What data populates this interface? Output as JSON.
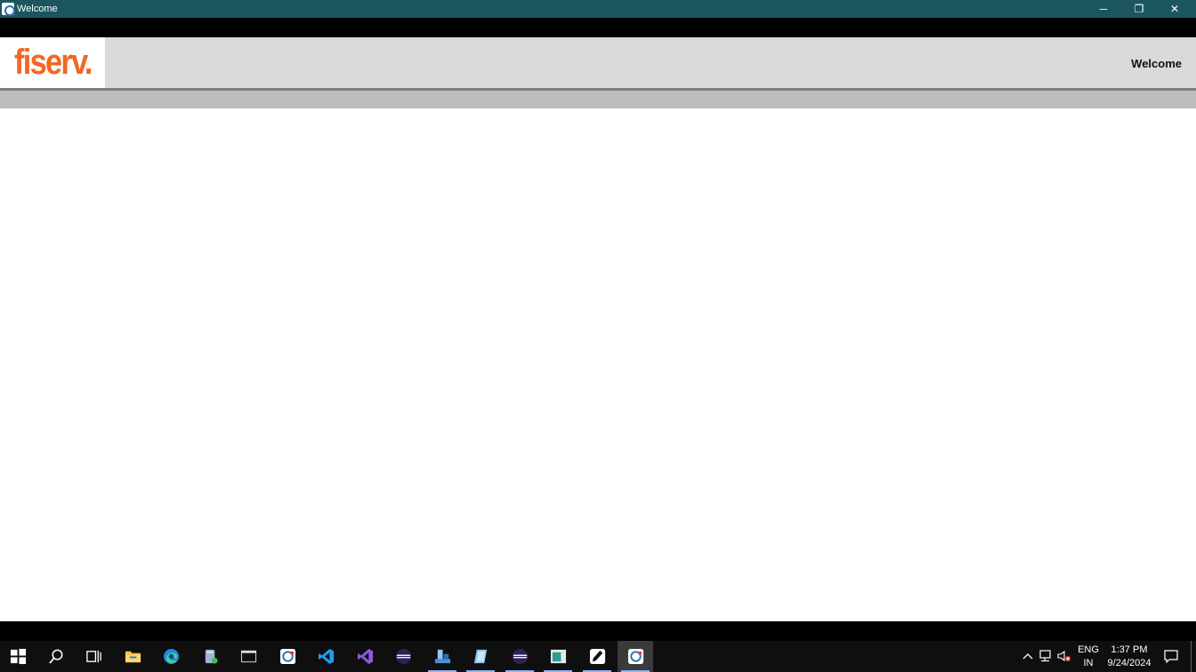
{
  "window": {
    "title": "Welcome",
    "minimize_glyph": "─",
    "restore_glyph": "❐",
    "close_glyph": "✕"
  },
  "header": {
    "logo": "fiserv.",
    "title": "Welcome"
  },
  "colors": {
    "titlebar": "#1b5560",
    "brand_orange": "#f26722",
    "header_bg": "#d9d9d9",
    "subbar": "#bdbdbd",
    "taskbar": "#0f0f0f"
  },
  "taskbar": {
    "items": [
      {
        "name": "start-button",
        "icon": "windows-icon"
      },
      {
        "name": "search-button",
        "icon": "search-icon"
      },
      {
        "name": "task-view-button",
        "icon": "task-view-icon"
      },
      {
        "name": "file-explorer",
        "icon": "folder-icon"
      },
      {
        "name": "edge",
        "icon": "edge-icon"
      },
      {
        "name": "app-database",
        "icon": "database-icon"
      },
      {
        "name": "terminal",
        "icon": "terminal-icon"
      },
      {
        "name": "app-refresh",
        "icon": "refresh-app-icon"
      },
      {
        "name": "vscode",
        "icon": "vscode-icon"
      },
      {
        "name": "visual-studio",
        "icon": "visual-studio-icon"
      },
      {
        "name": "eclipse",
        "icon": "eclipse-icon"
      },
      {
        "name": "app-chart",
        "icon": "chart-app-icon"
      },
      {
        "name": "app-notes",
        "icon": "notes-icon"
      },
      {
        "name": "eclipse-2",
        "icon": "eclipse-icon"
      },
      {
        "name": "app-window",
        "icon": "window-app-icon"
      },
      {
        "name": "app-pen",
        "icon": "pen-app-icon"
      },
      {
        "name": "app-welcome",
        "icon": "refresh-app-icon"
      }
    ],
    "tray": {
      "language": "ENG",
      "region": "IN",
      "time": "1:37 PM",
      "date": "9/24/2024"
    }
  }
}
